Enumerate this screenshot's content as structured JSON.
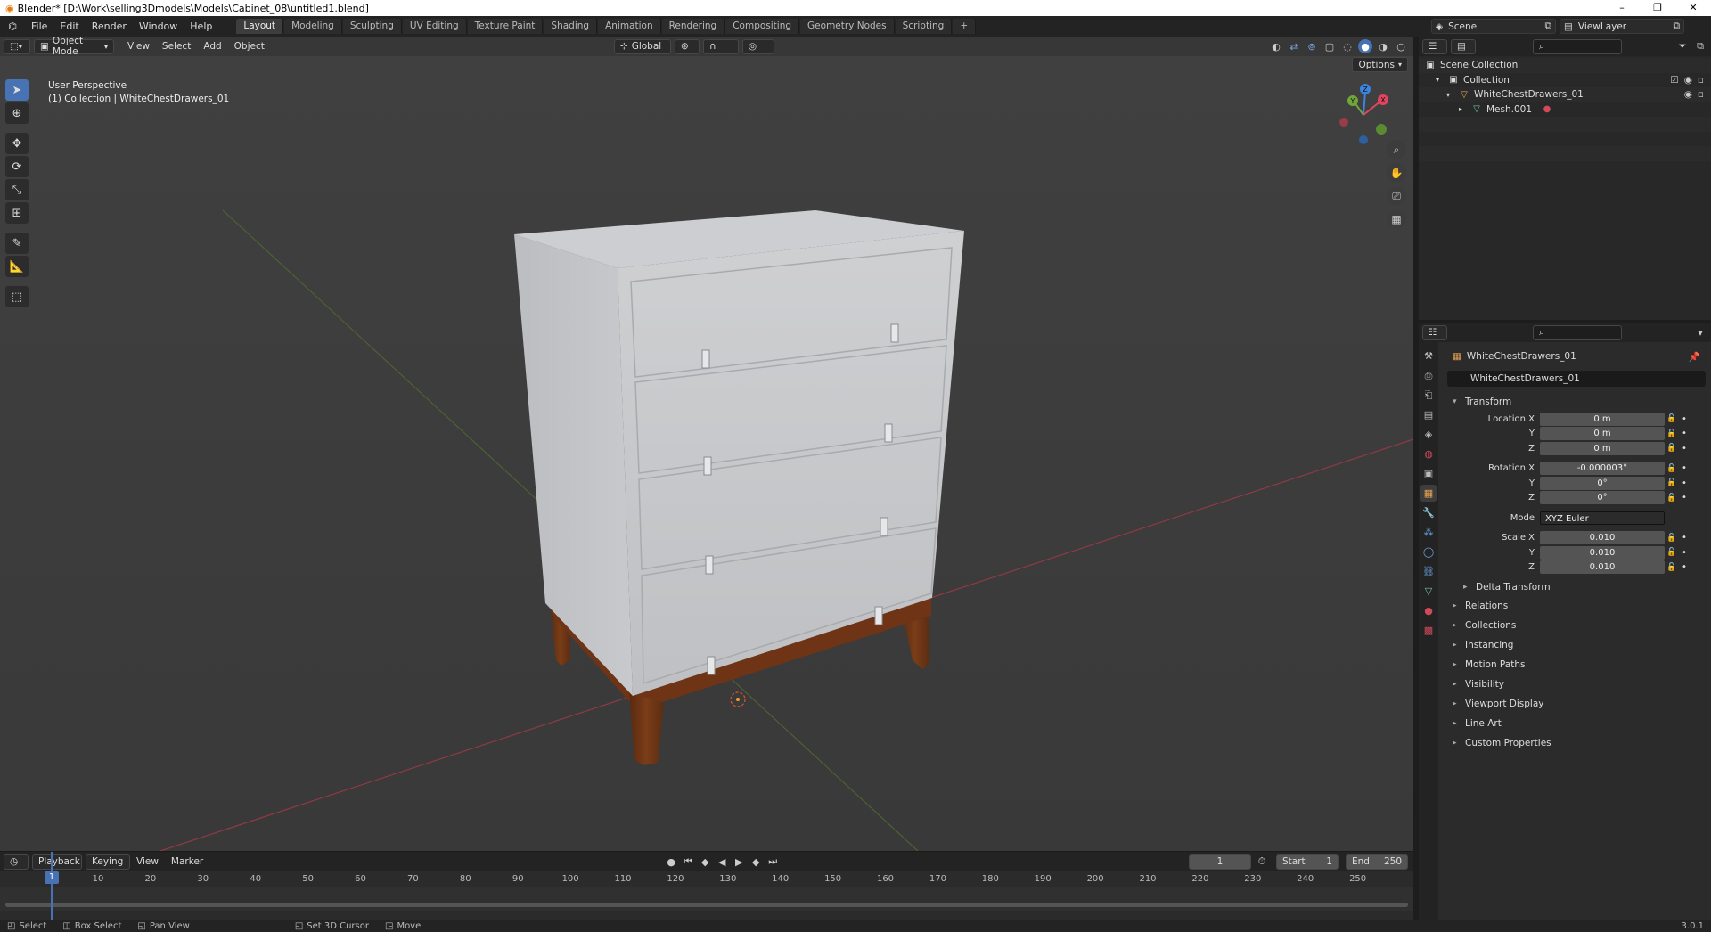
{
  "window": {
    "title": "Blender* [D:\\Work\\selling3Dmodels\\Models\\Cabinet_08\\untitled1.blend]",
    "minimize": "–",
    "maximize": "❐",
    "close": "✕"
  },
  "menu": {
    "items": [
      "File",
      "Edit",
      "Render",
      "Window",
      "Help"
    ]
  },
  "workspaces": {
    "tabs": [
      "Layout",
      "Modeling",
      "Sculpting",
      "UV Editing",
      "Texture Paint",
      "Shading",
      "Animation",
      "Rendering",
      "Compositing",
      "Geometry Nodes",
      "Scripting"
    ],
    "add": "+"
  },
  "scene": {
    "scene_name": "Scene",
    "view_layer": "ViewLayer"
  },
  "viewport": {
    "mode": "Object Mode",
    "menus": [
      "View",
      "Select",
      "Add",
      "Object"
    ],
    "orientation": "Global",
    "options": "Options",
    "perspective": "User Perspective",
    "collection_info": "(1) Collection | WhiteChestDrawers_01",
    "gizmo_labels": {
      "x": "X",
      "y": "Y",
      "z": "Z"
    }
  },
  "timeline": {
    "menus": [
      "Playback",
      "Keying",
      "View",
      "Marker"
    ],
    "current_frame": "1",
    "start_label": "Start",
    "start": "1",
    "end_label": "End",
    "end": "250",
    "ruler": [
      "1",
      "10",
      "20",
      "30",
      "40",
      "50",
      "60",
      "70",
      "80",
      "90",
      "100",
      "110",
      "120",
      "130",
      "140",
      "150",
      "160",
      "170",
      "180",
      "190",
      "200",
      "210",
      "220",
      "230",
      "240",
      "250"
    ]
  },
  "statusbar": {
    "select": "Select",
    "box_select": "Box Select",
    "pan_view": "Pan View",
    "set_cursor": "Set 3D Cursor",
    "move": "Move",
    "version": "3.0.1"
  },
  "outliner": {
    "rows": [
      {
        "label": "Scene Collection"
      },
      {
        "label": "Collection"
      },
      {
        "label": "WhiteChestDrawers_01"
      },
      {
        "label": "Mesh.001"
      }
    ]
  },
  "properties": {
    "object_name": "WhiteChestDrawers_01",
    "object_field": "WhiteChestDrawers_01",
    "transform_title": "Transform",
    "location": {
      "label": "Location X",
      "x": "0 m",
      "y": "0 m",
      "z": "0 m"
    },
    "rotation": {
      "label": "Rotation X",
      "x": "-0.000003°",
      "y": "0°",
      "z": "0°"
    },
    "mode": {
      "label": "Mode",
      "value": "XYZ Euler"
    },
    "scale": {
      "label": "Scale X",
      "x": "0.010",
      "y": "0.010",
      "z": "0.010"
    },
    "axis_y": "Y",
    "axis_z": "Z",
    "delta": "Delta Transform",
    "sections": [
      "Relations",
      "Collections",
      "Instancing",
      "Motion Paths",
      "Visibility",
      "Viewport Display",
      "Line Art",
      "Custom Properties"
    ]
  },
  "colors": {
    "accent": "#4772b3",
    "axis_x": "#e0455f",
    "axis_y": "#6fa53b",
    "axis_z": "#3d83e0",
    "wood": "#6b3416"
  }
}
